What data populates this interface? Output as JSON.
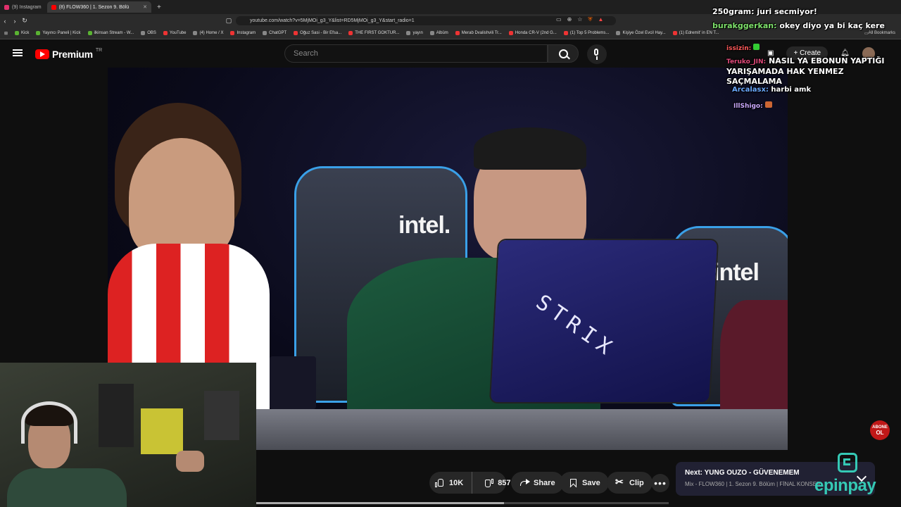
{
  "browser": {
    "tabs": [
      {
        "label": "(9) Instagram",
        "active": false
      },
      {
        "label": "(8) FLOW360 | 1. Sezon 9. Bölü",
        "active": true
      }
    ],
    "new_tab": "+",
    "url": "youtube.com/watch?v=5MjMOi_g3_Y&list=RD5MjMOi_g3_Y&start_radio=1",
    "bookmarks": [
      "Kick",
      "Yayıncı Paneli | Kick",
      "ilkinsan Stream - W...",
      "OBS",
      "YouTube",
      "(4) Home / X",
      "Instagram",
      "ChatGPT",
      "Oğuz Sasi - Bir Efsa...",
      "THE FIRST GOKTUR...",
      "yayın",
      "Albüm",
      "Merab Dvalishvili Tr...",
      "Honda CR-V (2nd G...",
      "(1) Top 5 Problems...",
      "Kişiye Özel Evcil Hay...",
      "(1) Edremit' in EN T..."
    ],
    "all_bookmarks": "All Bookmarks"
  },
  "youtube": {
    "logo_text": "Premium",
    "country_code": "TR",
    "search_placeholder": "Search",
    "create_label": "Create"
  },
  "video": {
    "brand_text_1": "intel.",
    "brand_text_2": "intel",
    "laptop_text": "STRIX",
    "progress_fraction": 0.6
  },
  "actions": {
    "like_count": "10K",
    "dislike_count": "857",
    "share_label": "Share",
    "save_label": "Save",
    "clip_label": "Clip",
    "more_label": "•••"
  },
  "next_card": {
    "title": "Next: YUNG OUZO - GÜVENEMEM",
    "subtitle": "Mix - FLOW360 | 1. Sezon 9. Bölüm | FİNAL KONSER"
  },
  "overlay": {
    "sponsor": "epinpay",
    "subscribe_badge": [
      "ABONE",
      "OL"
    ]
  },
  "chat": [
    {
      "user": "250gram:",
      "message": "juri secmiyor!",
      "user_color": "#ffffff"
    },
    {
      "user": "burakggerkan:",
      "message": "okey diyo ya bi kaç kere",
      "user_color": "#7ee06b"
    },
    {
      "user": "issizin:",
      "message": "",
      "user_color": "#ff5a5a"
    },
    {
      "user": "Teruko_JIN:",
      "message": "NASIL YA EBONUN YAPTIĞI YARIŞAMADA HAK YENMEZ SAÇMALAMA",
      "user_color": "#e14a7a"
    },
    {
      "user": "Arcalasx:",
      "message": "harbi amk",
      "user_color": "#6aa8ff"
    },
    {
      "user": "IllShigo:",
      "message": "",
      "user_color": "#c9a8ff"
    }
  ]
}
